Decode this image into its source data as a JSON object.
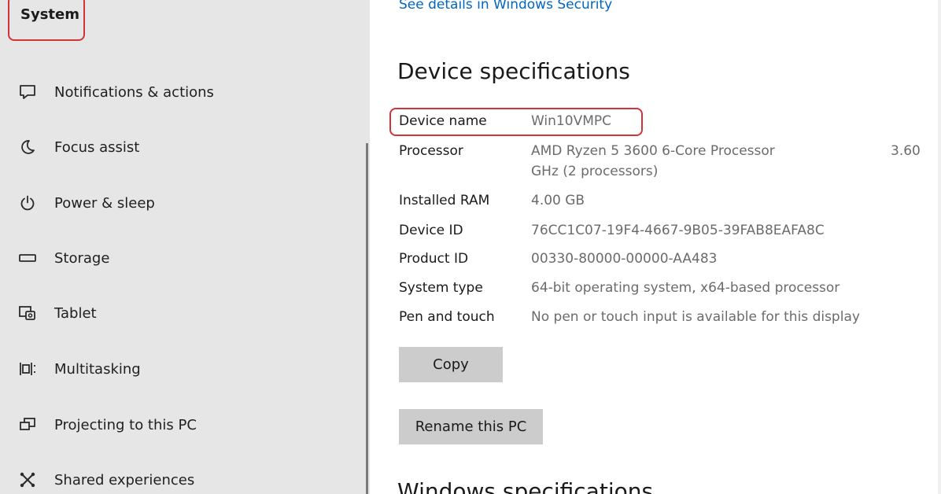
{
  "sidebar": {
    "system_label": "System",
    "items": [
      {
        "label": "Notifications & actions",
        "icon": "notifications-icon"
      },
      {
        "label": "Focus assist",
        "icon": "moon-icon"
      },
      {
        "label": "Power & sleep",
        "icon": "power-icon"
      },
      {
        "label": "Storage",
        "icon": "storage-icon"
      },
      {
        "label": "Tablet",
        "icon": "tablet-icon"
      },
      {
        "label": "Multitasking",
        "icon": "multitasking-icon"
      },
      {
        "label": "Projecting to this PC",
        "icon": "projecting-icon"
      },
      {
        "label": "Shared experiences",
        "icon": "shared-experiences-icon"
      }
    ]
  },
  "main": {
    "security_link": "See details in Windows Security",
    "device_specs_title": "Device specifications",
    "specs": {
      "device_name": {
        "label": "Device name",
        "value": "Win10VMPC"
      },
      "processor": {
        "label": "Processor",
        "value": "AMD Ryzen 5 3600 6-Core Processor",
        "speed": "3.60",
        "value_line2": "GHz  (2 processors)"
      },
      "installed_ram": {
        "label": "Installed RAM",
        "value": "4.00 GB"
      },
      "device_id": {
        "label": "Device ID",
        "value": "76CC1C07-19F4-4667-9B05-39FAB8EAFA8C"
      },
      "product_id": {
        "label": "Product ID",
        "value": "00330-80000-00000-AA483"
      },
      "system_type": {
        "label": "System type",
        "value": "64-bit operating system, x64-based processor"
      },
      "pen_touch": {
        "label": "Pen and touch",
        "value": "No pen or touch input is available for this display"
      }
    },
    "copy_button": "Copy",
    "rename_button": "Rename this PC",
    "windows_specs_title": "Windows specifications"
  },
  "colors": {
    "highlight": "#d13438",
    "link": "#0067c0",
    "sidebar_bg": "#e6e6e6",
    "button_bg": "#cccccc"
  }
}
